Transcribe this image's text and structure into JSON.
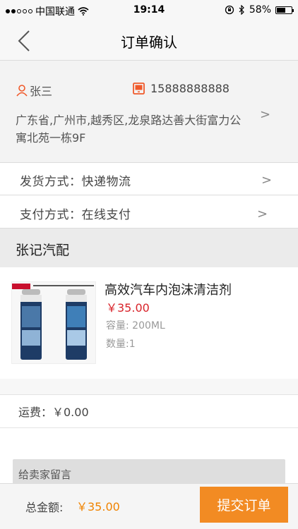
{
  "status_bar": {
    "carrier": "中国联通",
    "time": "19:14",
    "battery": "58%",
    "battery_level": 0.58
  },
  "nav": {
    "title": "订单确认"
  },
  "address": {
    "name": "张三",
    "phone": "15888888888",
    "detail": "广东省,广州市,越秀区,龙泉路达善大街富力公寓北苑一栋9F"
  },
  "delivery": {
    "label": "发货方式：快递物流"
  },
  "payment": {
    "label": "支付方式：在线支付"
  },
  "store": {
    "name": "张记汽配"
  },
  "product": {
    "title": "高效汽车内泡沫清洁剂",
    "price": "￥35.00",
    "spec": "容量: 200ML",
    "quantity": "数量:1"
  },
  "shipping": {
    "label": "运费：￥0.00"
  },
  "message": {
    "label": "给卖家留言"
  },
  "footer": {
    "total_label": "总金额:",
    "total_value": "￥35.00",
    "submit_label": "提交订单"
  },
  "colors": {
    "accent": "#f28b23",
    "price_red": "#d8232a",
    "icon_orange": "#f0592a"
  },
  "chevron": ">"
}
